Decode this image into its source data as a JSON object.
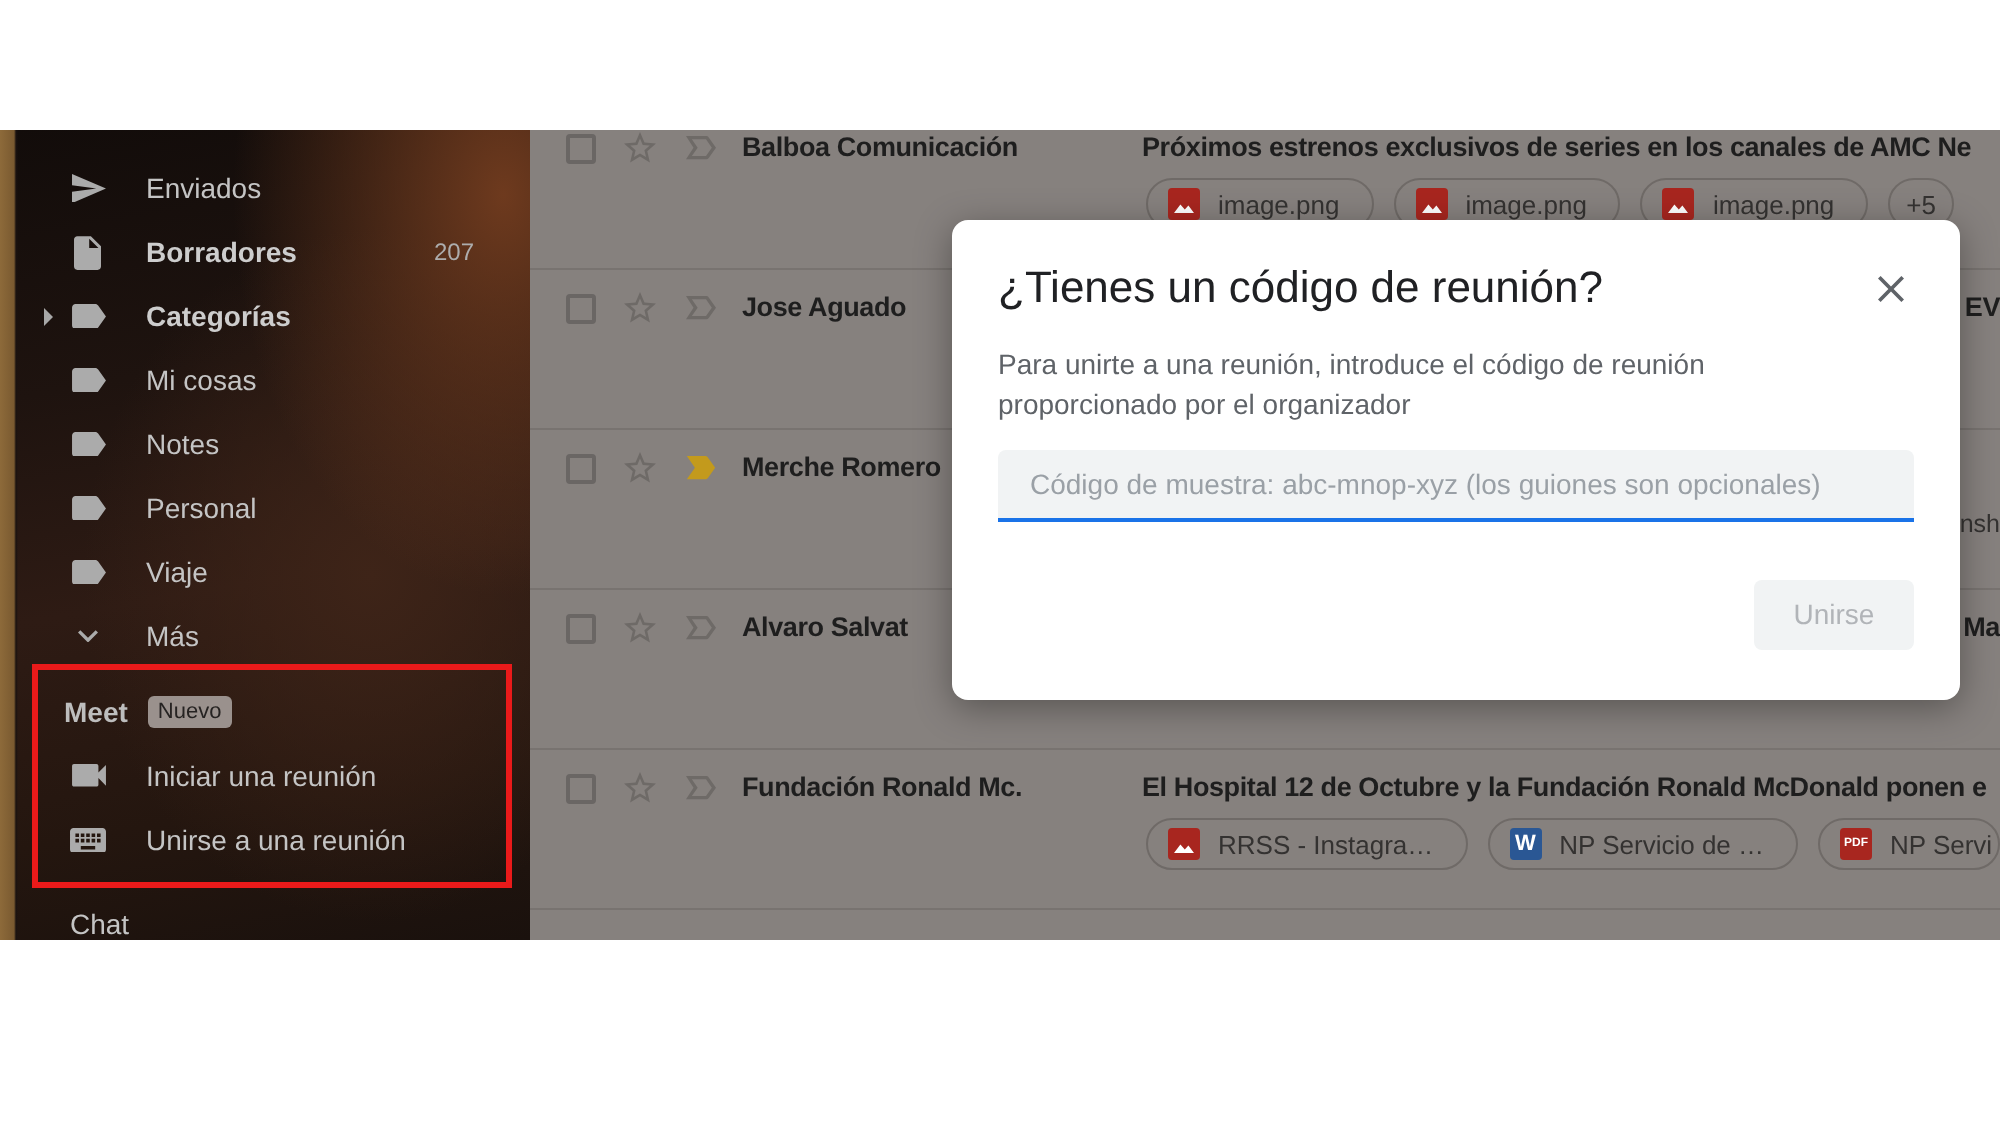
{
  "sidebar": {
    "items": [
      {
        "label": "Enviados",
        "unread": false
      },
      {
        "label": "Borradores",
        "unread": true,
        "count": "207"
      },
      {
        "label": "Categorías",
        "unread": true,
        "expanded": false
      },
      {
        "label": "Mi cosas",
        "unread": false
      },
      {
        "label": "Notes",
        "unread": false
      },
      {
        "label": "Personal",
        "unread": false
      },
      {
        "label": "Viaje",
        "unread": false
      },
      {
        "label": "Más",
        "unread": false
      }
    ],
    "meet": {
      "title": "Meet",
      "badge": "Nuevo",
      "highlighted": true,
      "items": [
        {
          "label": "Iniciar una reunión"
        },
        {
          "label": "Unirse a una reunión"
        }
      ]
    },
    "chat": {
      "title": "Chat"
    }
  },
  "emails": [
    {
      "checked": false,
      "starred": false,
      "important": false,
      "unread": true,
      "sender": "Balboa Comunicación",
      "subject": "Próximos estrenos exclusivos de series en los canales de AMC Ne",
      "attachments": [
        {
          "kind": "image",
          "name": "image.png"
        },
        {
          "kind": "image",
          "name": "image.png"
        },
        {
          "kind": "image",
          "name": "image.png"
        }
      ],
      "more_attachments": "+5"
    },
    {
      "checked": false,
      "starred": false,
      "important": false,
      "unread": true,
      "sender": "Jose Aguado",
      "subject_end": "EV"
    },
    {
      "checked": false,
      "starred": false,
      "important": true,
      "unread": true,
      "sender": "Merche Romero",
      "attachments_end": "nsh"
    },
    {
      "checked": false,
      "starred": false,
      "important": false,
      "unread": true,
      "sender": "Alvaro Salvat",
      "subject_end": "Ma"
    },
    {
      "checked": false,
      "starred": false,
      "important": false,
      "unread": true,
      "sender": "Fundación Ronald Mc.",
      "subject": "El Hospital 12 de Octubre y la Fundación Ronald McDonald ponen e",
      "attachments": [
        {
          "kind": "image",
          "name": "RRSS - Instagra…"
        },
        {
          "kind": "doc",
          "icon_text": "W",
          "name": "NP Servicio de …"
        },
        {
          "kind": "pdf",
          "icon_text": "PDF",
          "name": "NP Servi"
        }
      ]
    }
  ],
  "dialog": {
    "title": "¿Tienes un código de reunión?",
    "description": "Para unirte a una reunión, introduce el código de reunión proporcionado por el organizador",
    "input": {
      "placeholder": "Código de muestra: abc-mnop-xyz (los guiones son opcionales)",
      "focused": true
    },
    "button": {
      "label": "Unirse",
      "disabled": true
    }
  }
}
